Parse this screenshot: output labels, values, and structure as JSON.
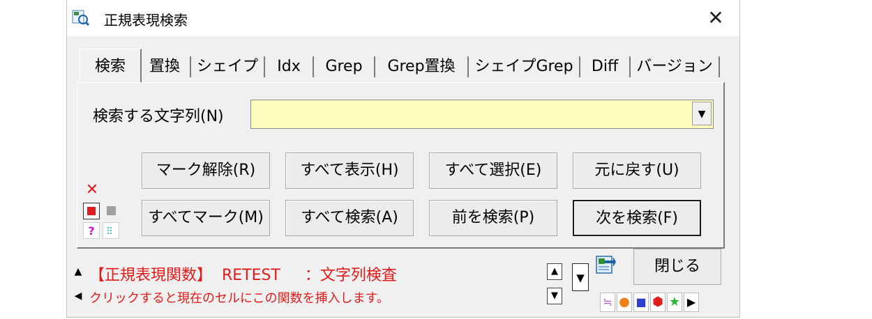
{
  "window": {
    "title": "正規表現検索",
    "close_glyph": "✕"
  },
  "tabs": [
    "検索",
    "置換",
    "シェイプ",
    "Idx",
    "Grep",
    "Grep置換",
    "シェイプGrep",
    "Diff",
    "バージョン"
  ],
  "search": {
    "label": "検索する文字列(N)",
    "value": ""
  },
  "buttons": {
    "clear_marks": "マーク解除(R)",
    "show_all": "すべて表示(H)",
    "select_all": "すべて選択(E)",
    "undo": "元に戻す(U)",
    "mark_all": "すべてマーク(M)",
    "search_all": "すべて検索(A)",
    "find_prev": "前を検索(P)",
    "find_next": "次を検索(F)",
    "close": "閉じる"
  },
  "status": {
    "line1": "【正規表現関数】  RETEST     ：文字列検査",
    "line2": "クリックすると現在のセルにこの関数を挿入します。"
  },
  "side_tools": {
    "delete": "✕",
    "help": "?"
  },
  "colors": {
    "status_text": "#e21a1a",
    "search_bg": "#fffdb9",
    "orange": "#f07f1a",
    "blue": "#2f3fcf",
    "red": "#e01e1e",
    "green": "#25b83a"
  }
}
